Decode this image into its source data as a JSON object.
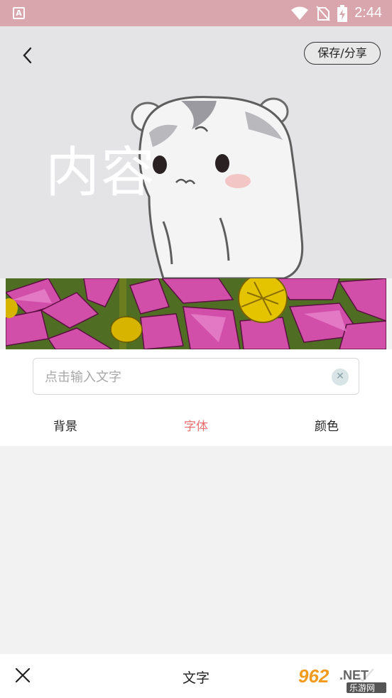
{
  "status_bar": {
    "time": "2:44",
    "left_icon_letter": "A"
  },
  "header": {
    "save_share_label": "保存/分享"
  },
  "canvas": {
    "overlay_text": "内容"
  },
  "editor": {
    "input_placeholder": "点击输入文字",
    "input_value": "",
    "tabs": [
      {
        "label": "背景",
        "active": false
      },
      {
        "label": "字体",
        "active": true
      },
      {
        "label": "颜色",
        "active": false
      }
    ]
  },
  "bottom_bar": {
    "title": "文字"
  },
  "watermark": {
    "number": "962",
    "suffix": ".NET",
    "site": "乐游网"
  },
  "colors": {
    "status_bar": "#d9a6ad",
    "accent": "#e96f6f",
    "background": "#f2f2f2"
  }
}
